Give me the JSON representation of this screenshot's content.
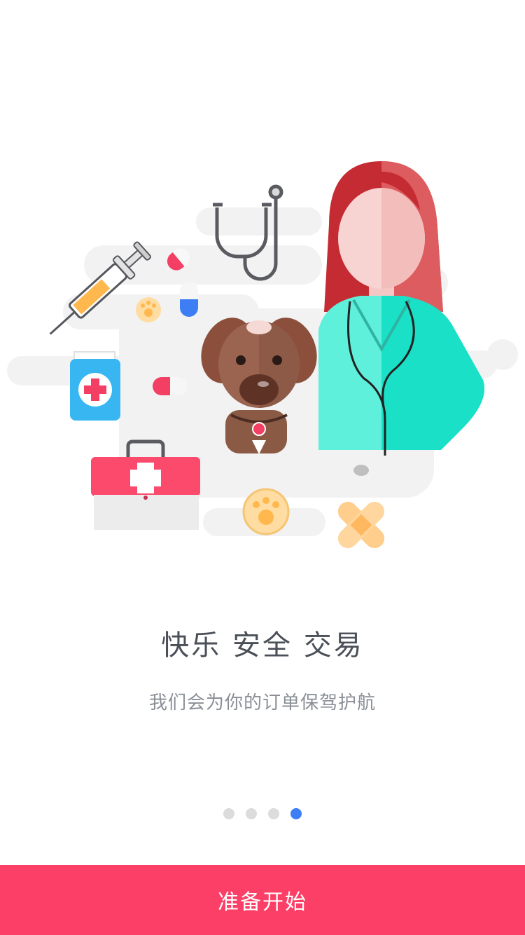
{
  "onboarding": {
    "headline": "快乐 安全 交易",
    "subline": "我们会为你的订单保驾护航",
    "pager": {
      "total": 4,
      "current": 4
    },
    "start_button_label": "准备开始"
  },
  "colors": {
    "accent": "#fb3f66",
    "active_dot": "#3d7ef5",
    "inactive_dot": "#dcdcdc",
    "headline_text": "#4a4f58",
    "subline_text": "#8a8f96"
  }
}
